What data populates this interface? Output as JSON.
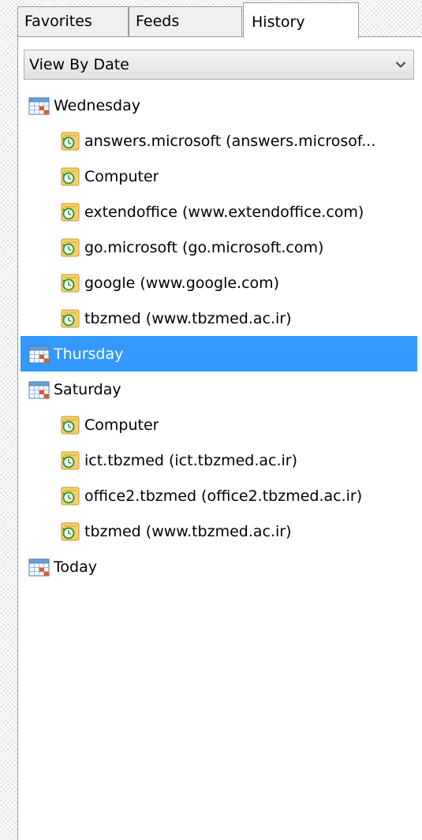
{
  "tabs": [
    {
      "label": "Favorites"
    },
    {
      "label": "Feeds"
    },
    {
      "label": "History"
    }
  ],
  "view_select": {
    "value": "View By Date"
  },
  "history": {
    "days": [
      {
        "label": "Wednesday",
        "sites": [
          {
            "label": "answers.microsoft (answers.microsof..."
          },
          {
            "label": "Computer"
          },
          {
            "label": "extendoffice (www.extendoffice.com)"
          },
          {
            "label": "go.microsoft (go.microsoft.com)"
          },
          {
            "label": "google (www.google.com)"
          },
          {
            "label": "tbzmed (www.tbzmed.ac.ir)"
          }
        ]
      },
      {
        "label": "Thursday",
        "selected": true,
        "sites": []
      },
      {
        "label": "Saturday",
        "sites": [
          {
            "label": "Computer"
          },
          {
            "label": "ict.tbzmed (ict.tbzmed.ac.ir)"
          },
          {
            "label": "office2.tbzmed (office2.tbzmed.ac.ir)"
          },
          {
            "label": "tbzmed (www.tbzmed.ac.ir)"
          }
        ]
      },
      {
        "label": "Today",
        "sites": []
      }
    ]
  },
  "icons": {
    "day": "calendar-icon",
    "site": "history-page-icon"
  },
  "colors": {
    "selection": "#3399ff",
    "selection_text": "#ffffff",
    "border": "#9a9a9a"
  }
}
